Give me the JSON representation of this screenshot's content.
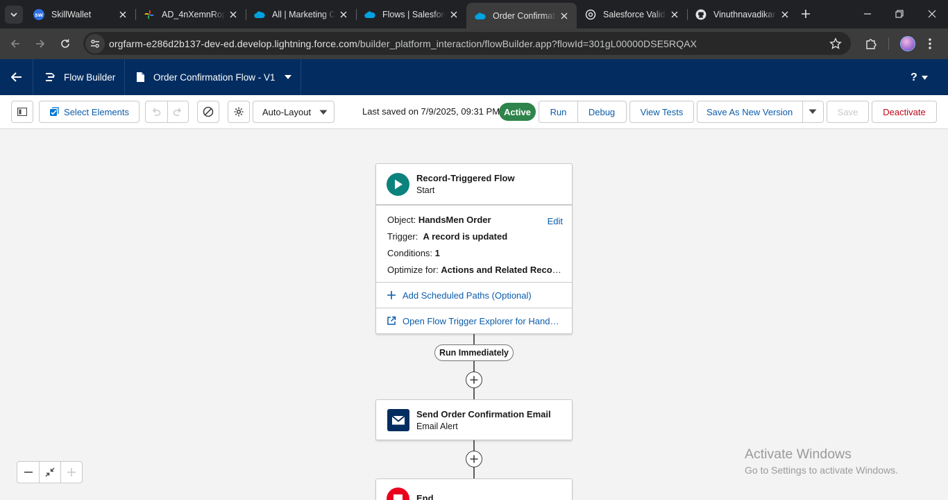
{
  "browser": {
    "tabs": [
      {
        "title": "SkillWallet",
        "icon": "skillwallet-icon"
      },
      {
        "title": "AD_4nXemnRop",
        "icon": "google-photos-icon"
      },
      {
        "title": "All | Marketing C",
        "icon": "salesforce-cloud-icon"
      },
      {
        "title": "Flows | Salesforce",
        "icon": "salesforce-cloud-icon"
      },
      {
        "title": "Order Confirmati",
        "icon": "salesforce-cloud-icon",
        "active": true
      },
      {
        "title": "Salesforce Valida",
        "icon": "chatgpt-icon"
      },
      {
        "title": "Vinuthnavadikar",
        "icon": "github-icon"
      }
    ],
    "url_host": "orgfarm-e286d2b137-dev-ed.develop.lightning.force.com",
    "url_path": "/builder_platform_interaction/flowBuilder.app?flowId=301gL00000DSE5RQAX"
  },
  "header": {
    "app_name": "Flow Builder",
    "flow_title": "Order Confirmation Flow - V1",
    "help_label": "?"
  },
  "toolbar": {
    "select_elements": "Select Elements",
    "layout": "Auto-Layout",
    "last_saved": "Last saved on 7/9/2025, 09:31 PM",
    "status": "Active",
    "run": "Run",
    "debug": "Debug",
    "view_tests": "View Tests",
    "save_as_new_version": "Save As New Version",
    "save": "Save",
    "deactivate": "Deactivate"
  },
  "canvas": {
    "start": {
      "title": "Record-Triggered Flow",
      "subtitle": "Start",
      "object_label": "Object:",
      "object_value": "HandsMen Order",
      "edit": "Edit",
      "trigger_label": "Trigger:",
      "trigger_value": "A record is updated",
      "conditions_label": "Conditions:",
      "conditions_value": "1",
      "optimize_label": "Optimize for:",
      "optimize_value": "Actions and Related Records",
      "add_scheduled_paths": "Add Scheduled Paths (Optional)",
      "open_trigger_explorer": "Open Flow Trigger Explorer for HandsMen Order"
    },
    "path_label": "Run Immediately",
    "email_node": {
      "title": "Send Order Confirmation Email",
      "subtitle": "Email Alert"
    },
    "end_node": {
      "title": "End"
    }
  },
  "watermark": {
    "line1": "Activate Windows",
    "line2": "Go to Settings to activate Windows."
  },
  "colors": {
    "sf_header": "#032d60",
    "brand_blue": "#0b5cab",
    "active_green": "#2e844a",
    "start_teal": "#0b827c",
    "email_navy": "#032d60",
    "end_red": "#ea001e",
    "deactivate_red": "#ba0517"
  }
}
